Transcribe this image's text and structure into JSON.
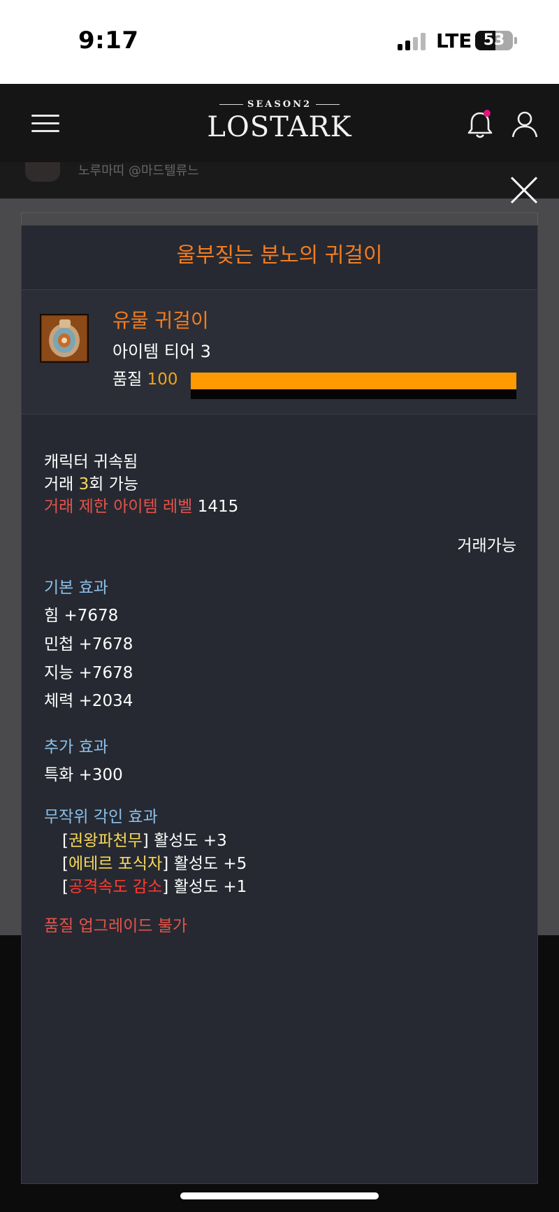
{
  "status_bar": {
    "time": "9:17",
    "network": "LTE",
    "battery": "53"
  },
  "header": {
    "logo_season": "SEASON2",
    "logo_text": "LOSTARK"
  },
  "background": {
    "strip_text": "노루마띠 @마드텔류느"
  },
  "modal": {
    "title": "울부짖는 분노의 귀걸이",
    "item": {
      "grade": "유물 귀걸이",
      "tier": "아이템 티어 3",
      "quality_label": "품질",
      "quality_value": "100",
      "quality_percent": 100
    },
    "bind": "캐릭터 귀속됨",
    "trade_prefix": "거래 ",
    "trade_count": "3",
    "trade_suffix": "회 가능",
    "trade_limit_label": "거래 제한 아이템 레벨",
    "trade_limit_value": "1415",
    "tradable": "거래가능",
    "base_effects": {
      "title": "기본 효과",
      "stats": [
        "힘 +7678",
        "민첩 +7678",
        "지능 +7678",
        "체력 +2034"
      ]
    },
    "extra_effects": {
      "title": "추가 효과",
      "stats": [
        "특화 +300"
      ]
    },
    "engravings": {
      "title": "무작위 각인 효과",
      "items": [
        {
          "name": "권왕파천무",
          "value": "활성도 +3",
          "color": "#f8d95a"
        },
        {
          "name": "에테르 포식자",
          "value": "활성도 +5",
          "color": "#f8d95a"
        },
        {
          "name": "공격속도 감소",
          "value": "활성도 +1",
          "color": "#ff3b30"
        }
      ]
    },
    "quality_upgrade": "품질 업그레이드 불가"
  }
}
